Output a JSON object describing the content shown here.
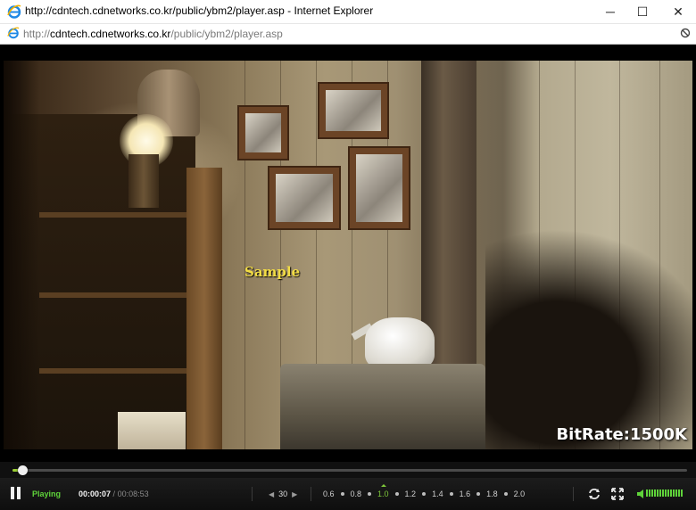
{
  "window": {
    "title": "http://cdntech.cdnetworks.co.kr/public/ybm2/player.asp - Internet Explorer",
    "minimize_label": "─",
    "maximize_label": "☐",
    "close_label": "✕"
  },
  "address": {
    "scheme": "http://",
    "host": "cdntech.cdnetworks.co.kr",
    "path": "/public/ybm2/player.asp"
  },
  "video": {
    "watermark": "Sample",
    "bitrate_label": "BitRate:1500K",
    "progress_fraction": 0.014
  },
  "controls": {
    "status": "Playing",
    "current_time": "00:00:07",
    "separator": "/",
    "duration": "00:08:53",
    "skip_seconds": "30",
    "skip_back_icon": "◀",
    "skip_fwd_icon": "▶",
    "speeds": [
      "0.6",
      "0.8",
      "1.0",
      "1.2",
      "1.4",
      "1.6",
      "1.8",
      "2.0"
    ],
    "active_speed_index": 2,
    "volume_level": 1.0,
    "accent_color": "#5fd33a"
  },
  "icons": {
    "browser": "internet-explorer-icon",
    "addr_page": "ie-page-icon",
    "block": "blocked-icon",
    "pause": "pause-icon",
    "repeat": "repeat-icon",
    "fullscreen": "fullscreen-icon",
    "volume": "volume-icon"
  }
}
